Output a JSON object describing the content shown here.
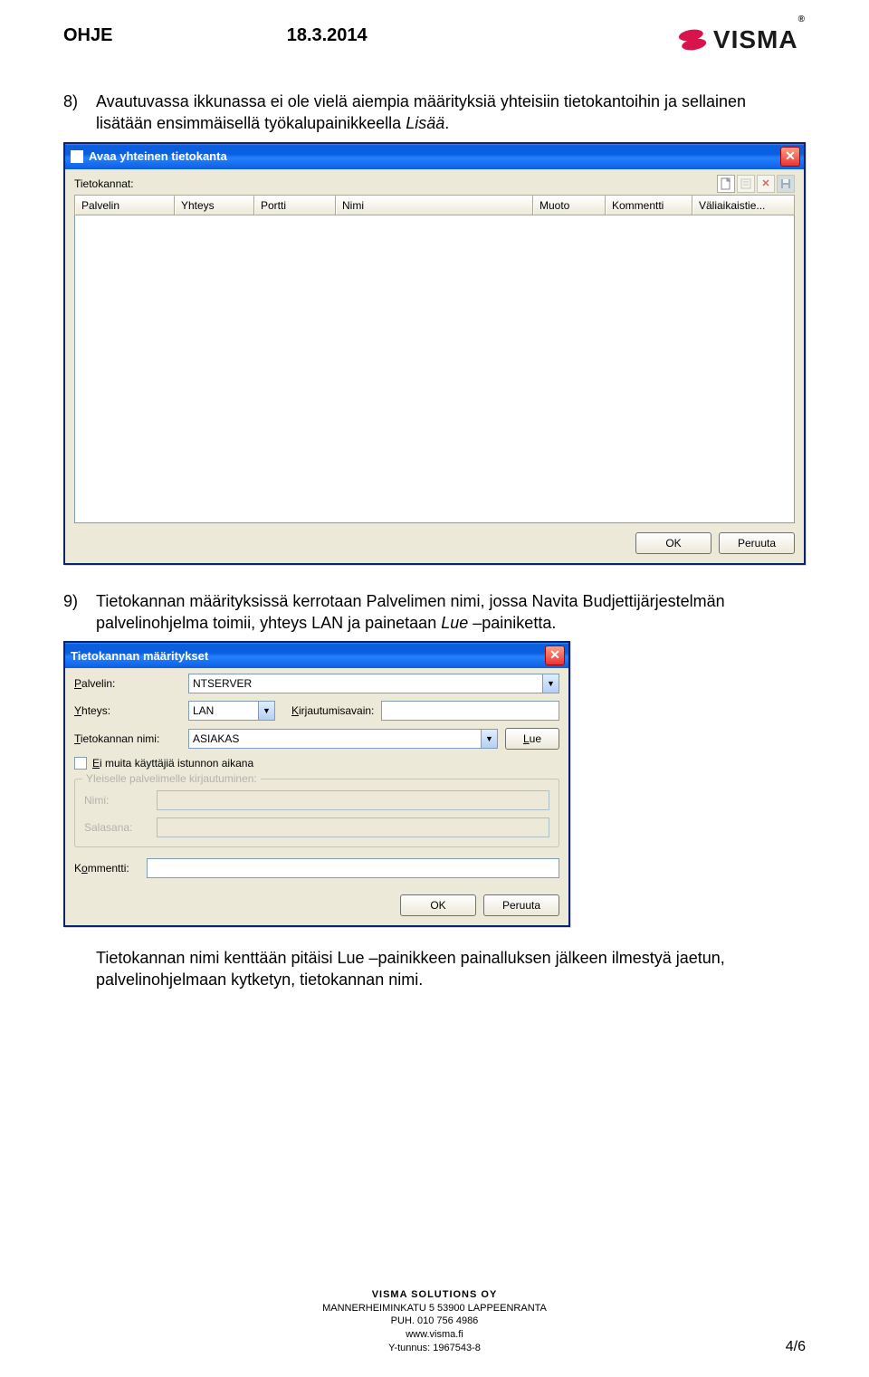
{
  "header": {
    "title": "OHJE",
    "date": "18.3.2014",
    "logo_text": "VISMA",
    "logo_reg": "®"
  },
  "para8": {
    "num": "8)",
    "text_a": "Avautuvassa ikkunassa ei ole vielä aiempia määrityksiä yhteisiin tietokantoihin ja sellainen lisätään ensimmäisellä työkalupainikkeella ",
    "text_b": "Lisää",
    "text_c": "."
  },
  "dialog1": {
    "title": "Avaa yhteinen tietokanta",
    "label_tk": "Tietokannat:",
    "icons": {
      "new": "new-icon",
      "edit": "edit-icon",
      "delete": "delete-icon",
      "save": "save-icon"
    },
    "cols": [
      "Palvelin",
      "Yhteys",
      "Portti",
      "Nimi",
      "Muoto",
      "Kommentti",
      "Väliaikaistie..."
    ],
    "ok": "OK",
    "cancel": "Peruuta"
  },
  "para9": {
    "num": "9)",
    "text_a": "Tietokannan määrityksissä kerrotaan Palvelimen nimi, jossa Navita Budjettijärjestelmän palvelinohjelma toimii, yhteys LAN ja painetaan ",
    "text_b": "Lue",
    "text_c": " –painiketta."
  },
  "dialog2": {
    "title": "Tietokannan määritykset",
    "lbl_palvelin": "Palvelin:",
    "val_palvelin": "NTSERVER",
    "lbl_yhteys": "Yhteys:",
    "val_yhteys": "LAN",
    "lbl_kirjautumisavain": "Kirjautumisavain:",
    "val_kirjautumisavain": "",
    "lbl_tknimi": "Tietokannan nimi:",
    "val_tknimi": "ASIAKAS",
    "btn_lue": "Lue",
    "cb_label": "Ei muita käyttäjiä istunnon aikana",
    "group_title": "Yleiselle palvelimelle kirjautuminen:",
    "lbl_nimi": "Nimi:",
    "lbl_salasana": "Salasana:",
    "lbl_kommentti": "Kommentti:",
    "val_kommentti": "",
    "ok": "OK",
    "cancel": "Peruuta"
  },
  "para_after": "Tietokannan nimi kenttään pitäisi Lue –painikkeen painalluksen jälkeen ilmestyä jaetun, palvelinohjelmaan kytketyn, tietokannan nimi.",
  "footer": {
    "l1": "VISMA SOLUTIONS OY",
    "l2": "MANNERHEIMINKATU 5   53900 LAPPEENRANTA",
    "l3": "PUH. 010 756 4986",
    "l4": "www.visma.fi",
    "l5": "Y-tunnus: 1967543-8"
  },
  "page_num": "4/6"
}
